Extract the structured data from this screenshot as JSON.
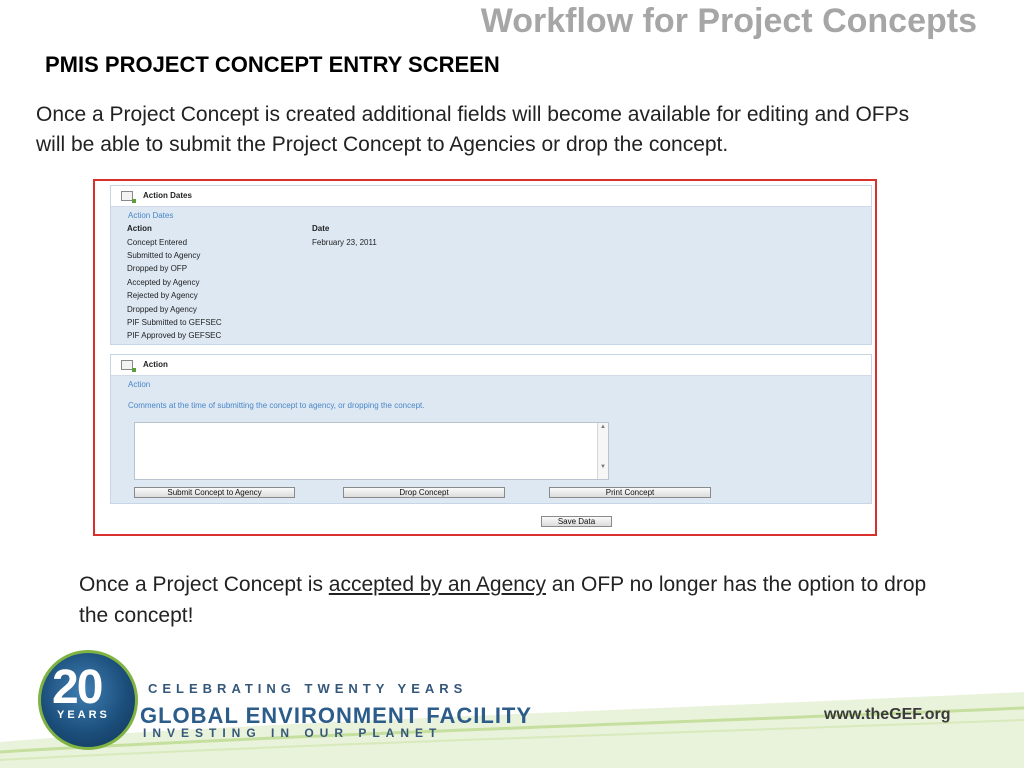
{
  "slide": {
    "title": "Workflow for Project Concepts",
    "subtitle": "PMIS PROJECT CONCEPT ENTRY SCREEN",
    "intro": "Once a Project Concept is created additional fields will become available for editing and OFPs will be able to submit the Project Concept to Agencies or drop the concept.",
    "note_before": "Once a Project Concept is ",
    "note_highlight": "accepted by an Agency",
    "note_after": " an OFP no longer has the option to drop the concept!"
  },
  "action_dates_panel": {
    "header": "Action Dates",
    "section_label": "Action Dates",
    "col_action": "Action",
    "col_date": "Date",
    "rows": [
      {
        "action": "Concept Entered",
        "date": "February 23, 2011"
      },
      {
        "action": "Submitted to Agency",
        "date": ""
      },
      {
        "action": "Dropped by OFP",
        "date": ""
      },
      {
        "action": "Accepted by Agency",
        "date": ""
      },
      {
        "action": "Rejected by Agency",
        "date": ""
      },
      {
        "action": "Dropped by Agency",
        "date": ""
      },
      {
        "action": "PIF Submitted to GEFSEC",
        "date": ""
      },
      {
        "action": "PIF Approved by GEFSEC",
        "date": ""
      }
    ]
  },
  "action_panel": {
    "header": "Action",
    "section_label": "Action",
    "comment_label": "Comments at the time of submitting the concept to agency, or dropping the concept.",
    "comment_value": "",
    "submit_label": "Submit Concept to Agency",
    "drop_label": "Drop Concept",
    "print_label": "Print Concept"
  },
  "save_label": "Save Data",
  "footer": {
    "logo_number": "20",
    "logo_years": "YEARS",
    "celebrating": "CELEBRATING TWENTY YEARS",
    "org_name": "GLOBAL ENVIRONMENT FACILITY",
    "tagline": "INVESTING IN OUR PLANET",
    "url": "www.theGEF.org"
  },
  "colors": {
    "frame_border": "#d9302c",
    "panel_bg": "#dde8f3",
    "label_blue": "#4a86c5",
    "title_gray": "#a6a6a6"
  }
}
